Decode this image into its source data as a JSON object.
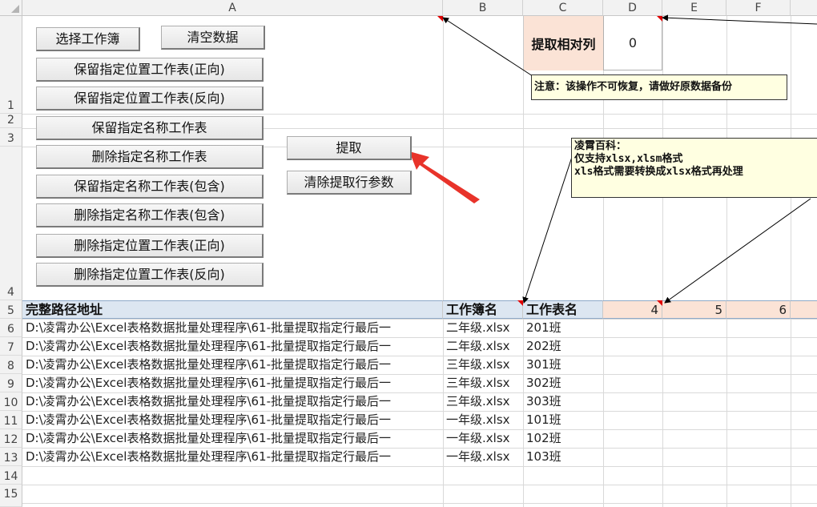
{
  "columns": [
    "A",
    "B",
    "C",
    "D",
    "E",
    "F"
  ],
  "rows": [
    "1",
    "2",
    "3",
    "4",
    "5",
    "6",
    "7",
    "8",
    "9",
    "10",
    "11",
    "12",
    "13",
    "14",
    "15"
  ],
  "buttons": {
    "select_workbook": "选择工作簿",
    "clear_data": "清空数据",
    "keep_pos_fwd": "保留指定位置工作表(正向)",
    "keep_pos_rev": "保留指定位置工作表(反向)",
    "keep_name": "保留指定名称工作表",
    "delete_name": "删除指定名称工作表",
    "keep_name_contains": "保留指定名称工作表(包含)",
    "delete_name_contains": "删除指定名称工作表(包含)",
    "delete_pos_fwd": "删除指定位置工作表(正向)",
    "delete_pos_rev": "删除指定位置工作表(反向)",
    "extract": "提取",
    "clear_extract_params": "清除提取行参数"
  },
  "params": {
    "label": "提取相对列",
    "value": "0"
  },
  "notes": {
    "warning": "注意：该操作不可恢复，请做好原数据备份",
    "info_lines": [
      "凌霄百科：",
      "仅支持xlsx,xlsm格式",
      "xls格式需要转换成xlsx格式再处理"
    ]
  },
  "table": {
    "headers": [
      "完整路径地址",
      "工作簿名",
      "工作表名"
    ],
    "extra_headers": [
      "4",
      "5",
      "6"
    ],
    "rows": [
      {
        "path": "D:\\凌霄办公\\Excel表格数据批量处理程序\\61-批量提取指定行最后一",
        "workbook": "二年级.xlsx",
        "sheet": "201班"
      },
      {
        "path": "D:\\凌霄办公\\Excel表格数据批量处理程序\\61-批量提取指定行最后一",
        "workbook": "二年级.xlsx",
        "sheet": "202班"
      },
      {
        "path": "D:\\凌霄办公\\Excel表格数据批量处理程序\\61-批量提取指定行最后一",
        "workbook": "三年级.xlsx",
        "sheet": "301班"
      },
      {
        "path": "D:\\凌霄办公\\Excel表格数据批量处理程序\\61-批量提取指定行最后一",
        "workbook": "三年级.xlsx",
        "sheet": "302班"
      },
      {
        "path": "D:\\凌霄办公\\Excel表格数据批量处理程序\\61-批量提取指定行最后一",
        "workbook": "三年级.xlsx",
        "sheet": "303班"
      },
      {
        "path": "D:\\凌霄办公\\Excel表格数据批量处理程序\\61-批量提取指定行最后一",
        "workbook": "一年级.xlsx",
        "sheet": "101班"
      },
      {
        "path": "D:\\凌霄办公\\Excel表格数据批量处理程序\\61-批量提取指定行最后一",
        "workbook": "一年级.xlsx",
        "sheet": "102班"
      },
      {
        "path": "D:\\凌霄办公\\Excel表格数据批量处理程序\\61-批量提取指定行最后一",
        "workbook": "一年级.xlsx",
        "sheet": "103班"
      }
    ]
  },
  "colors": {
    "peach_fill": "#fbe3d6",
    "header_fill": "#dce6f1",
    "note_fill": "#ffffe1",
    "arrow_red": "#e8332a"
  }
}
